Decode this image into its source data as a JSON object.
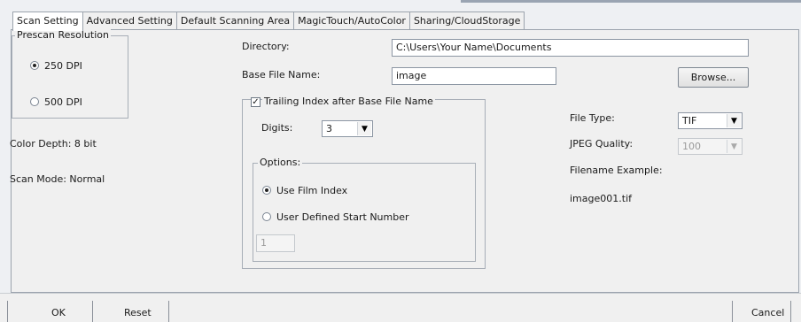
{
  "tabs": [
    {
      "label": "Scan Setting",
      "active": true
    },
    {
      "label": "Advanced Setting",
      "active": false
    },
    {
      "label": "Default Scanning Area",
      "active": false
    },
    {
      "label": "MagicTouch/AutoColor",
      "active": false
    },
    {
      "label": "Sharing/CloudStorage",
      "active": false
    }
  ],
  "prescan": {
    "title": "Prescan Resolution",
    "options": [
      {
        "label": "250 DPI",
        "selected": true
      },
      {
        "label": "500 DPI",
        "selected": false
      }
    ]
  },
  "info": {
    "color_depth": "Color Depth: 8 bit",
    "scan_mode": "Scan Mode: Normal"
  },
  "directory": {
    "label": "Directory:",
    "value": "C:\\Users\\Your Name\\Documents"
  },
  "base_file": {
    "label": "Base File Name:",
    "value": "image"
  },
  "browse_label": "Browse...",
  "trailing": {
    "label": "Trailing Index after Base File Name",
    "checked": true,
    "digits_label": "Digits:",
    "digits_value": "3",
    "options_title": "Options:",
    "use_film_index": "Use Film Index",
    "user_defined": "User Defined Start Number",
    "start_number": "1"
  },
  "file_type": {
    "label": "File Type:",
    "value": "TIF"
  },
  "jpeg_quality": {
    "label": "JPEG Quality:",
    "value": "100"
  },
  "filename_example": {
    "label": "Filename Example:",
    "value": "image001.tif"
  },
  "footer": {
    "ok": "OK",
    "reset": "Reset",
    "cancel": "Cancel"
  }
}
